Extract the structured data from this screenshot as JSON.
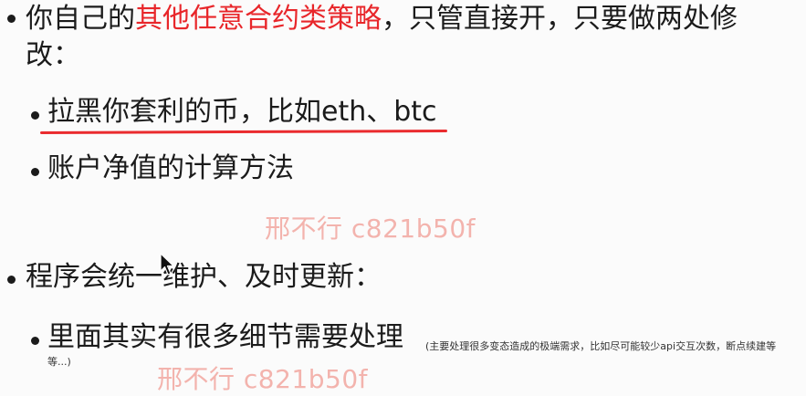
{
  "bullets": {
    "b1": {
      "prefix": "你自己的",
      "highlight": "其他任意合约类策略",
      "suffix": "，只管直接开，只要做两处修",
      "cont": "改："
    },
    "b1a": "拉黑你套利的币，比如eth、btc",
    "b1b": "账户净值的计算方法",
    "b2": "程序会统一维护、及时更新：",
    "b2a": {
      "text": "里面其实有很多细节需要处理",
      "note1": "(主要处理很多变态造成的极端需求，比如尽可能较少api交互次数，断点续建等",
      "note2": "等...)"
    }
  },
  "watermarks": {
    "w1": "邢不行 c821b50f",
    "w2": "邢不行 c821b50f"
  },
  "colors": {
    "highlight": "#e8262a",
    "underline": "#ea2b2e",
    "watermark": "#ec786e"
  }
}
